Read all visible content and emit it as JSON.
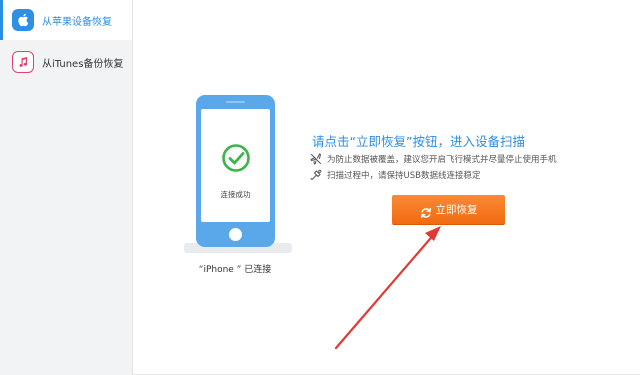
{
  "sidebar": {
    "items": [
      {
        "label": "从苹果设备恢复",
        "icon": "apple-icon",
        "active": true
      },
      {
        "label": "从iTunes备份恢复",
        "icon": "music-note-icon",
        "active": false
      }
    ]
  },
  "main": {
    "device": {
      "status_text": "连接成功",
      "caption": "“iPhone ” 已连接"
    },
    "headline": "请点击“立即恢复”按钮，进入设备扫描",
    "tips": [
      {
        "icon": "airplane-icon",
        "text": "为防止数据被覆盖，建议您开启飞行模式并尽量停止使用手机"
      },
      {
        "icon": "usb-icon",
        "text": "扫描过程中，请保持USB数据线连接稳定"
      }
    ],
    "restore_button": {
      "label": "立即恢复",
      "icon": "refresh-icon"
    }
  },
  "colors": {
    "accent": "#2b8ee6",
    "button": "#f57a22",
    "phone": "#5aa8ea",
    "success": "#3bb54a",
    "annotation_arrow": "#e03a35"
  }
}
